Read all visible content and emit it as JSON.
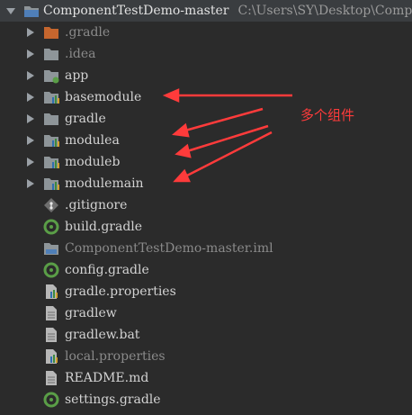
{
  "root": {
    "name": "ComponentTestDemo-master",
    "path": "C:\\Users\\SY\\Desktop\\Comp"
  },
  "items": [
    {
      "label": "gradle-dotted",
      "text": ".gradle"
    },
    {
      "label": "idea",
      "text": ".idea"
    },
    {
      "label": "app",
      "text": "app"
    },
    {
      "label": "basemodule",
      "text": "basemodule"
    },
    {
      "label": "gradle",
      "text": "gradle"
    },
    {
      "label": "modulea",
      "text": "modulea"
    },
    {
      "label": "moduleb",
      "text": "moduleb"
    },
    {
      "label": "modulemain",
      "text": "modulemain"
    },
    {
      "label": "gitignore",
      "text": ".gitignore"
    },
    {
      "label": "build-gradle",
      "text": "build.gradle"
    },
    {
      "label": "iml",
      "text": "ComponentTestDemo-master.iml"
    },
    {
      "label": "config-gradle",
      "text": "config.gradle"
    },
    {
      "label": "gradle-properties",
      "text": "gradle.properties"
    },
    {
      "label": "gradlew",
      "text": "gradlew"
    },
    {
      "label": "gradlew-bat",
      "text": "gradlew.bat"
    },
    {
      "label": "local-properties",
      "text": "local.properties"
    },
    {
      "label": "readme",
      "text": "README.md"
    },
    {
      "label": "settings-gradle",
      "text": "settings.gradle"
    }
  ],
  "annotation": {
    "text": "多个组件",
    "color": "#ff3b3b"
  },
  "colors": {
    "background": "#2b2b2b",
    "selected_row": "#3a3d40",
    "folder": "#8e9599",
    "gradle_icon": "#5a9e47",
    "annotation": "#ff3b3b"
  }
}
